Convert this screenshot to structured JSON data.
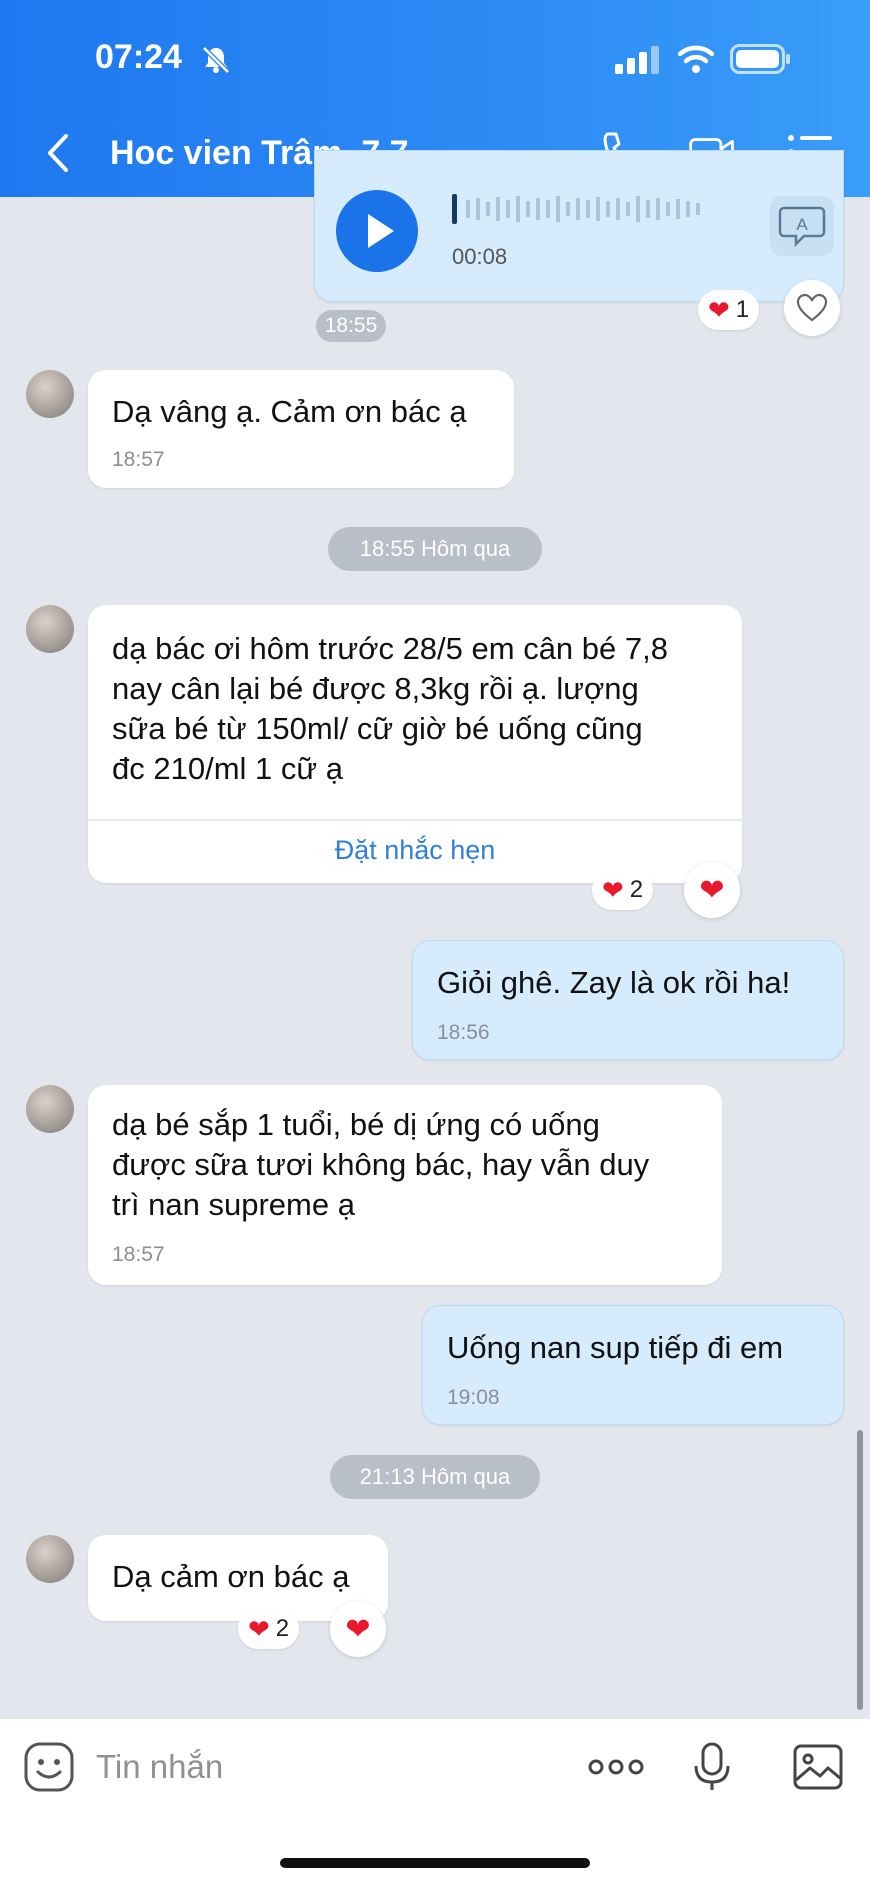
{
  "status_bar": {
    "time": "07:24"
  },
  "header": {
    "title": "Hoc vien Trâm. 7.7"
  },
  "voice_message": {
    "duration": "00:08",
    "reaction_count": "1"
  },
  "timestamps": {
    "t1": "18:55",
    "t2": "18:55 Hôm qua",
    "t3": "21:13 Hôm qua"
  },
  "messages": [
    {
      "text": "Dạ vâng ạ. Cảm ơn bác ạ",
      "time": "18:57"
    },
    {
      "text": "dạ bác ơi hôm trước 28/5 em cân bé 7,8\nnay cân lại bé được 8,3kg rồi ạ. lượng\nsữa bé từ 150ml/ cữ giờ bé uống cũng\nđc 210/ml 1 cữ ạ",
      "action": "Đặt nhắc hẹn",
      "reaction_count": "2"
    },
    {
      "text": "Giỏi ghê. Zay là ok rồi ha!",
      "time": "18:56"
    },
    {
      "text": "dạ bé sắp 1 tuổi, bé dị ứng có uống\nđược sữa tươi không bác, hay vẫn duy\ntrì nan supreme ạ",
      "time": "18:57"
    },
    {
      "text": "Uống nan sup tiếp đi em",
      "time": "19:08"
    },
    {
      "text": "Dạ cảm ơn bác ạ",
      "reaction_count": "2"
    }
  ],
  "input": {
    "placeholder": "Tin nhắn"
  },
  "colors": {
    "header": "#2d8cf5",
    "my_bubble": "#d6ecfd",
    "accent": "#1a73e8",
    "heart": "#e8192c"
  }
}
